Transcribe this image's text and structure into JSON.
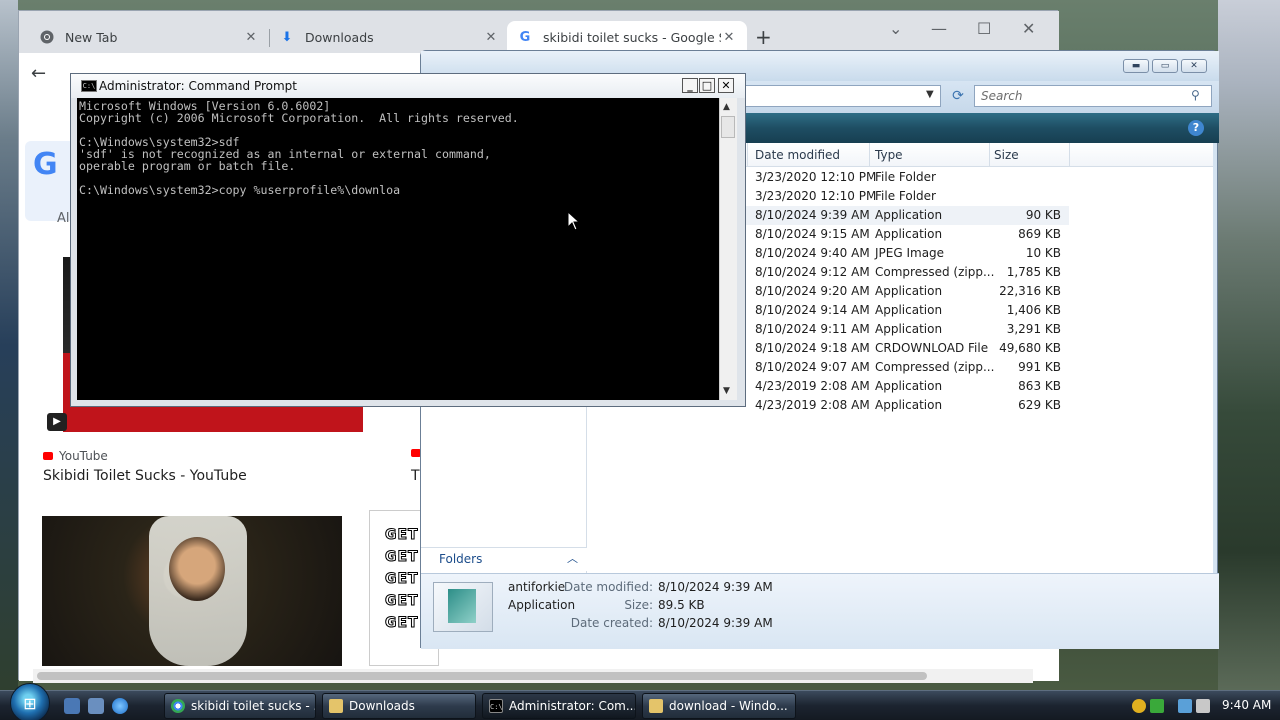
{
  "chrome": {
    "tabs": [
      {
        "label": "New Tab",
        "icon": "chrome-icon"
      },
      {
        "label": "Downloads",
        "icon": "download-icon"
      },
      {
        "label": "skibidi toilet sucks - Google Sear",
        "icon": "google-icon"
      }
    ],
    "google_all_tab": "Al",
    "results": [
      {
        "source": "YouTube",
        "title": "Skibidi Toilet Sucks - YouTube"
      },
      {
        "source": "",
        "title": "Tl"
      }
    ],
    "thumb3_text": [
      "GET",
      "GET",
      "GET",
      "GET",
      "GET"
    ]
  },
  "explorer": {
    "search_placeholder": "Search",
    "columns": [
      "Date modified",
      "Type",
      "Size"
    ],
    "files": [
      {
        "date": "3/23/2020 12:10 PM",
        "type": "File Folder",
        "size": ""
      },
      {
        "date": "3/23/2020 12:10 PM",
        "type": "File Folder",
        "size": ""
      },
      {
        "date": "8/10/2024 9:39 AM",
        "type": "Application",
        "size": "90 KB"
      },
      {
        "date": "8/10/2024 9:15 AM",
        "type": "Application",
        "size": "869 KB"
      },
      {
        "date": "8/10/2024 9:40 AM",
        "type": "JPEG Image",
        "size": "10 KB"
      },
      {
        "date": "8/10/2024 9:12 AM",
        "type": "Compressed (zipp...",
        "size": "1,785 KB"
      },
      {
        "date": "8/10/2024 9:20 AM",
        "type": "Application",
        "size": "22,316 KB"
      },
      {
        "date": "8/10/2024 9:14 AM",
        "type": "Application",
        "size": "1,406 KB"
      },
      {
        "date": "8/10/2024 9:11 AM",
        "type": "Application",
        "size": "3,291 KB"
      },
      {
        "date": "8/10/2024 9:18 AM",
        "type": "CRDOWNLOAD File",
        "size": "49,680 KB"
      },
      {
        "date": "8/10/2024 9:07 AM",
        "type": "Compressed (zipp...",
        "size": "991 KB"
      },
      {
        "date": "4/23/2019 2:08 AM",
        "type": "Application",
        "size": "863 KB"
      },
      {
        "date": "4/23/2019 2:08 AM",
        "type": "Application",
        "size": "629 KB"
      }
    ],
    "folders_label": "Folders",
    "details": {
      "name": "antiforkie",
      "kind": "Application",
      "date_modified_label": "Date modified:",
      "date_modified": "8/10/2024 9:39 AM",
      "size_label": "Size:",
      "size": "89.5 KB",
      "date_created_label": "Date created:",
      "date_created": "8/10/2024 9:39 AM"
    }
  },
  "cmd": {
    "title": "Administrator: Command Prompt",
    "output": "Microsoft Windows [Version 6.0.6002]\nCopyright (c) 2006 Microsoft Corporation.  All rights reserved.\n\nC:\\Windows\\system32>sdf\n'sdf' is not recognized as an internal or external command,\noperable program or batch file.\n\nC:\\Windows\\system32>copy %userprofile%\\downloa"
  },
  "taskbar": {
    "buttons": [
      {
        "label": "skibidi toilet sucks - ..."
      },
      {
        "label": "Downloads"
      },
      {
        "label": "Administrator: Com..."
      },
      {
        "label": "download - Windo..."
      }
    ],
    "clock": "9:40 AM"
  },
  "colors": {
    "cmd_bg": "#000000",
    "cmd_fg": "#c0c0c0",
    "explorer_cmdbar": "#1e4e63",
    "taskbar": "#1c2430",
    "chrome_tabbar": "#dee1e6"
  }
}
